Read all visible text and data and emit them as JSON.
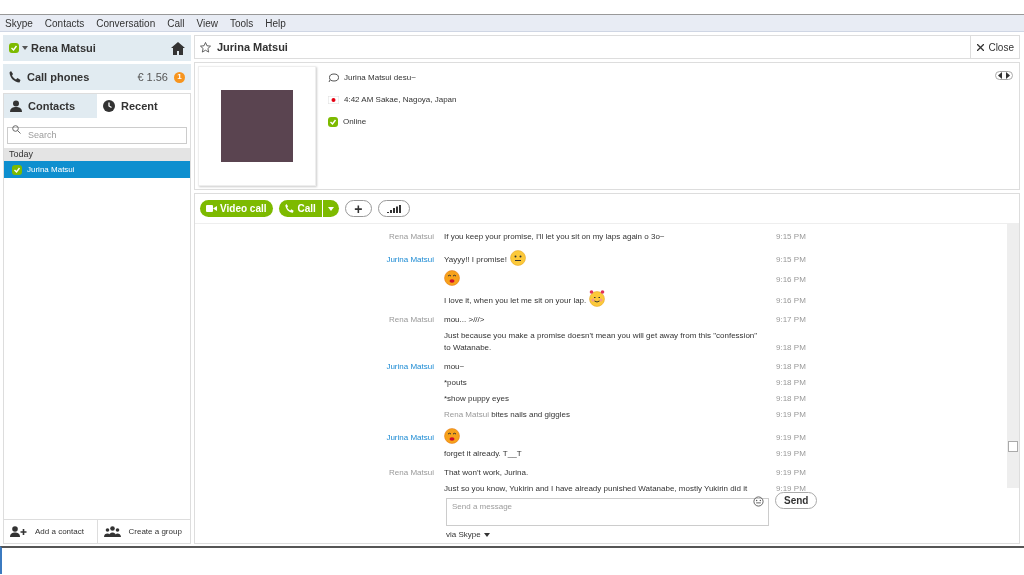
{
  "menu": [
    "Skype",
    "Contacts",
    "Conversation",
    "Call",
    "View",
    "Tools",
    "Help"
  ],
  "account": {
    "name": "Rena Matsui"
  },
  "call_phones": {
    "label": "Call phones",
    "credit": "€ 1.56",
    "badge": "1"
  },
  "tabs": [
    {
      "label": "Contacts",
      "selected": false
    },
    {
      "label": "Recent",
      "selected": true
    }
  ],
  "search": {
    "placeholder": "Search"
  },
  "recent": {
    "group": "Today",
    "items": [
      {
        "name": "Jurina Matsui",
        "selected": true
      }
    ]
  },
  "sidebar_footer": [
    {
      "label": "Add a contact"
    },
    {
      "label": "Create a group"
    }
  ],
  "conversation": {
    "title": "Jurina Matsui",
    "close": "Close",
    "mood": "Jurina Matsui desu~",
    "local_time": "4:42 AM Sakae, Nagoya, Japan",
    "status": "Online"
  },
  "actions": [
    {
      "kind": "video",
      "label": "Video call"
    },
    {
      "kind": "call",
      "label": "Call"
    },
    {
      "kind": "add",
      "label": "+"
    },
    {
      "kind": "signal"
    }
  ],
  "messages": [
    {
      "sender": "Rena Matsui",
      "own": true,
      "text": "If you keep your promise, I'll let you sit on my laps again o 3o~",
      "time": "9:15 PM"
    },
    {
      "sender": "Jurina Matsui",
      "own": false,
      "text": "Yayyy!! I promise!",
      "emoticon": {
        "kind": "smile"
      },
      "time": "9:15 PM"
    },
    {
      "emoticon": {
        "kind": "kiss"
      },
      "time": "9:16 PM"
    },
    {
      "text": "I love it, when you let me sit on your lap.",
      "emoticon": {
        "kind": "blush"
      },
      "time": "9:16 PM"
    },
    {
      "sender": "Rena Matsui",
      "own": true,
      "text": "mou... >///>",
      "time": "9:17 PM"
    },
    {
      "text": "Just because you make a promise doesn't mean you will get away from this \"confession\" to Watanabe.",
      "time": "9:18 PM"
    },
    {
      "sender": "Jurina Matsui",
      "own": false,
      "text": "mou~",
      "time": "9:18 PM"
    },
    {
      "text": "*pouts",
      "time": "9:18 PM"
    },
    {
      "text": "*show puppy eyes",
      "time": "9:18 PM"
    },
    {
      "actor": "Rena Matsui",
      "text": "bites nails and giggles",
      "time": "9:19 PM"
    },
    {
      "sender": "Jurina Matsui",
      "own": false,
      "emoticon": {
        "kind": "kiss"
      },
      "time": "9:19 PM"
    },
    {
      "text": "forget it already. T__T",
      "time": "9:19 PM"
    },
    {
      "sender": "Rena Matsui",
      "own": true,
      "text": "That won't work, Jurina.",
      "time": "9:19 PM"
    },
    {
      "text": "Just so you know, Yukirin and I have already punished Watanabe, mostly Yukirin did it",
      "time": "9:19 PM"
    }
  ],
  "composer": {
    "placeholder": "Send a message",
    "send": "Send",
    "via": "via Skype"
  }
}
